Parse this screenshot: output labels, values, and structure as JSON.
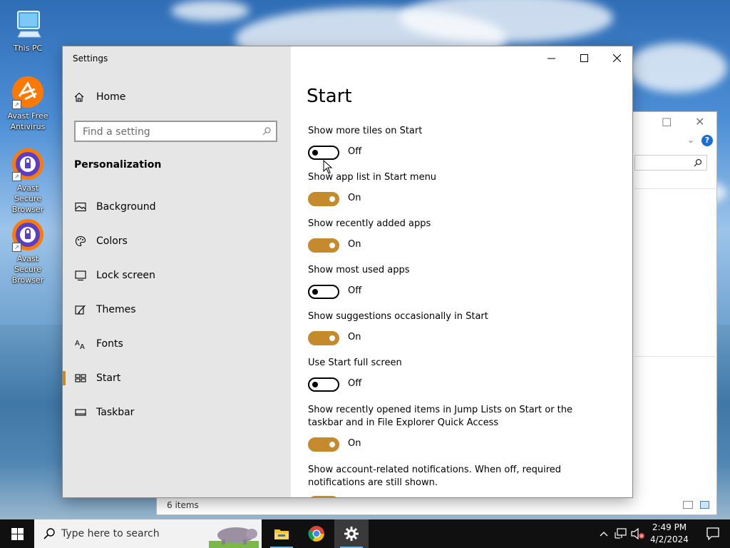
{
  "desktop": {
    "icons": [
      {
        "label": "This PC",
        "icon": "this-pc-icon"
      },
      {
        "label": "Avast Free Antivirus",
        "icon": "avast-antivirus-icon"
      },
      {
        "label": "Avast Secure Browser",
        "icon": "avast-browser-icon"
      },
      {
        "label": "Avast Secure Browser",
        "icon": "avast-browser-icon"
      }
    ]
  },
  "explorer": {
    "status": "6 items"
  },
  "settings": {
    "app_title": "Settings",
    "home_label": "Home",
    "search_placeholder": "Find a setting",
    "section_title": "Personalization",
    "nav": [
      {
        "label": "Background",
        "icon": "picture-icon"
      },
      {
        "label": "Colors",
        "icon": "palette-icon"
      },
      {
        "label": "Lock screen",
        "icon": "lock-screen-icon"
      },
      {
        "label": "Themes",
        "icon": "themes-icon"
      },
      {
        "label": "Fonts",
        "icon": "fonts-icon"
      },
      {
        "label": "Start",
        "icon": "start-icon",
        "active": true
      },
      {
        "label": "Taskbar",
        "icon": "taskbar-icon"
      }
    ],
    "page_title": "Start",
    "options": [
      {
        "label": "Show more tiles on Start",
        "state": "Off"
      },
      {
        "label": "Show app list in Start menu",
        "state": "On"
      },
      {
        "label": "Show recently added apps",
        "state": "On"
      },
      {
        "label": "Show most used apps",
        "state": "Off"
      },
      {
        "label": "Show suggestions occasionally in Start",
        "state": "On"
      },
      {
        "label": "Use Start full screen",
        "state": "Off"
      },
      {
        "label": "Show recently opened items in Jump Lists on Start or the taskbar and in File Explorer Quick Access",
        "state": "On"
      },
      {
        "label": "Show account-related notifications. When off, required notifications are still shown.",
        "state": "On"
      }
    ],
    "accent_color": "#c58a2b"
  },
  "taskbar": {
    "search_placeholder": "Type here to search",
    "apps": [
      "file-explorer-icon",
      "chrome-icon",
      "settings-gear-icon"
    ],
    "time": "2:49 PM",
    "date": "4/2/2024"
  }
}
